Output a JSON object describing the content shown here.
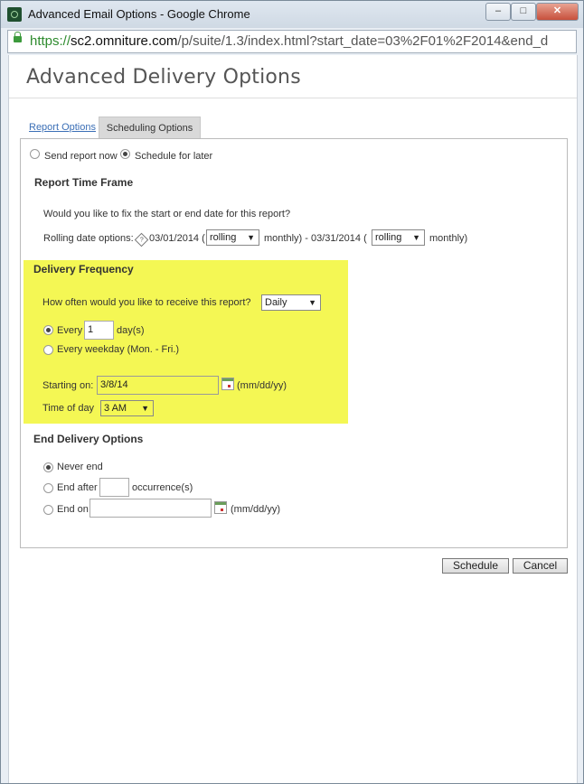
{
  "window": {
    "title": "Advanced Email Options - Google Chrome",
    "controls": {
      "minimize": "–",
      "maximize": "□",
      "close": "✕"
    }
  },
  "address_bar": {
    "scheme": "https://",
    "host": "sc2.omniture.com",
    "path": "/p/suite/1.3/index.html?start_date=03%2F01%2F2014&end_d"
  },
  "page": {
    "title": "Advanced Delivery Options",
    "tabs": [
      {
        "label": "Report Options",
        "active": false
      },
      {
        "label": "Scheduling Options",
        "active": true
      }
    ],
    "send_mode": {
      "now_label": "Send report now",
      "later_label": "Schedule for later",
      "selected": "later"
    },
    "time_frame": {
      "heading": "Report Time Frame",
      "question": "Would you like to fix the start or end date for this report?",
      "prefix": "Rolling date options:",
      "start_date": "03/01/2014 (",
      "start_select": "rolling",
      "start_suffix": "monthly) - 03/31/2014 (",
      "end_select": "rolling",
      "end_suffix": "monthly)"
    },
    "delivery": {
      "heading": "Delivery Frequency",
      "question": "How often would you like to receive this report?",
      "frequency": "Daily",
      "every_label": "Every",
      "every_value": "1",
      "every_unit": "day(s)",
      "weekday_label": "Every weekday (Mon. - Fri.)",
      "starting_label": "Starting on:",
      "starting_value": "3/8/14",
      "date_format": "(mm/dd/yy)",
      "time_label": "Time of day",
      "time_value": "3 AM",
      "highlight_color": "#f4f754"
    },
    "end_delivery": {
      "heading": "End Delivery Options",
      "never_label": "Never end",
      "after_label": "End after",
      "after_value": "",
      "after_unit": "occurrence(s)",
      "on_label": "End on",
      "on_value": "",
      "date_format": "(mm/dd/yy)",
      "selected": "never"
    },
    "buttons": {
      "schedule": "Schedule",
      "cancel": "Cancel"
    }
  }
}
